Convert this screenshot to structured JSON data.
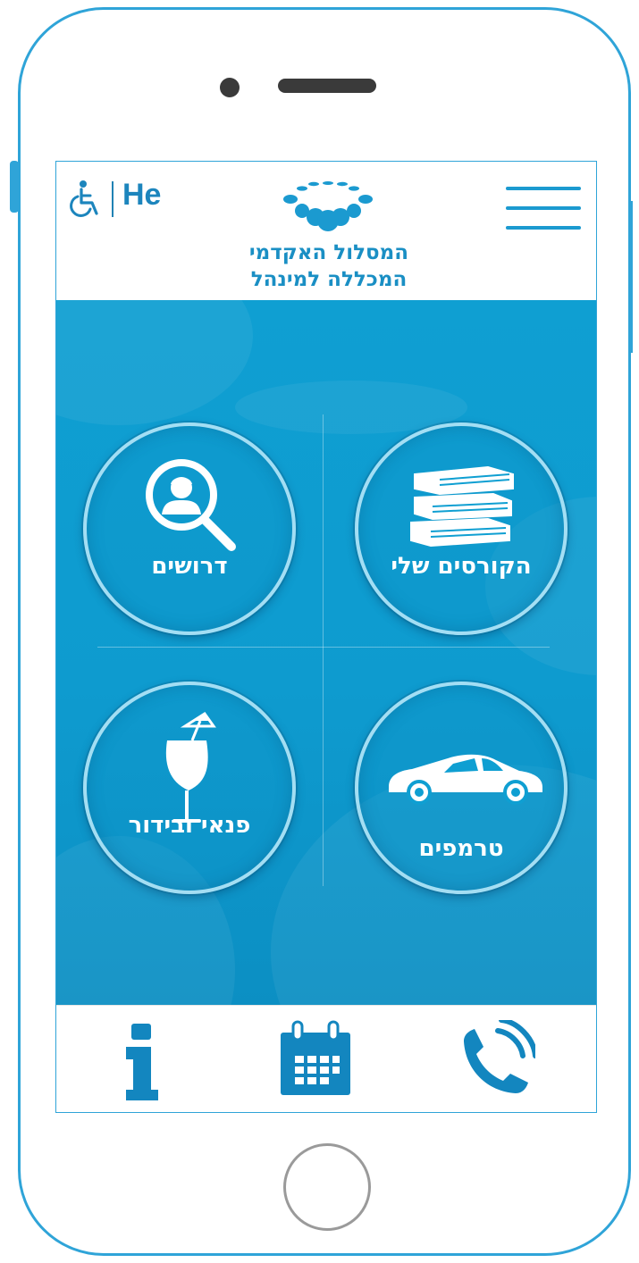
{
  "header": {
    "language": "He",
    "logo_line1": "המסלול האקדמי",
    "logo_line2": "המכללה למינהל"
  },
  "tiles": [
    {
      "id": "my-courses",
      "label": "הקורסים שלי",
      "icon": "books-icon"
    },
    {
      "id": "wanted",
      "label": "דרושים",
      "icon": "person-search-icon"
    },
    {
      "id": "rides",
      "label": "טרמפים",
      "icon": "car-icon"
    },
    {
      "id": "leisure",
      "label": "פנאי ובידור",
      "icon": "cocktail-icon"
    }
  ],
  "tab_bar": [
    {
      "id": "info",
      "icon": "info-icon"
    },
    {
      "id": "calendar",
      "icon": "calendar-icon"
    },
    {
      "id": "contact",
      "icon": "phone-icon"
    }
  ],
  "colors": {
    "accent": "#1b9ad0",
    "main_background": "#0f9fd2",
    "tab_icon": "#1386bf"
  }
}
